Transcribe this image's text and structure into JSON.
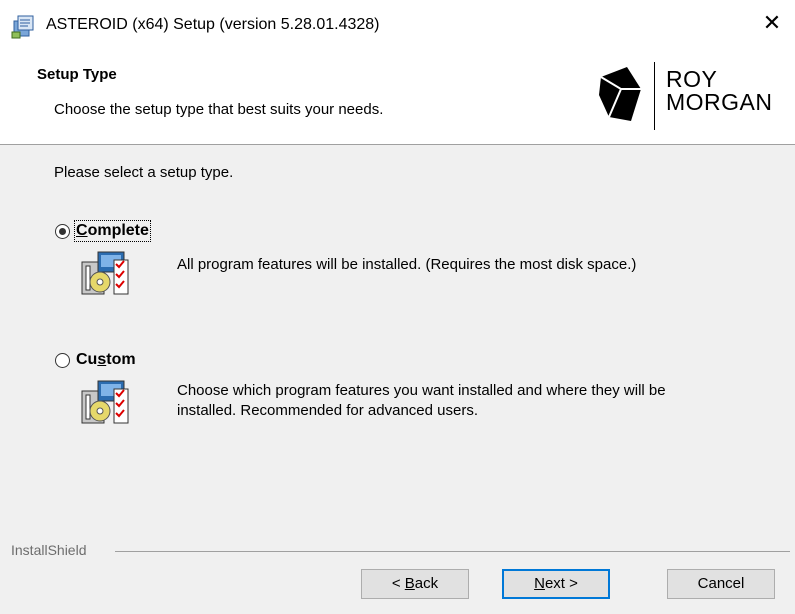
{
  "window": {
    "title": "ASTEROID (x64) Setup (version 5.28.01.4328)",
    "close_glyph": "✕"
  },
  "header": {
    "title": "Setup Type",
    "subtitle": "Choose the setup type that best suits your needs."
  },
  "logo": {
    "line1": "ROY",
    "line2": "MORGAN"
  },
  "prompt": "Please select a setup type.",
  "options": [
    {
      "label_pre": "",
      "label_u": "C",
      "label_post": "omplete",
      "selected": true,
      "description": "All program features will be installed. (Requires the most disk space.)"
    },
    {
      "label_pre": "Cu",
      "label_u": "s",
      "label_post": "tom",
      "selected": false,
      "description": "Choose which program features you want installed and where they will be installed. Recommended for advanced users."
    }
  ],
  "footer": {
    "brand": "InstallShield"
  },
  "buttons": {
    "back": {
      "pre": "< ",
      "u": "B",
      "post": "ack"
    },
    "next": {
      "pre": "",
      "u": "N",
      "post": "ext >"
    },
    "cancel": "Cancel"
  },
  "colors": {
    "accent": "#0078d7",
    "divider": "#a0a0a0"
  },
  "icons": {
    "app": "setup-package-icon",
    "logo": "roy-morgan-logo-mark",
    "feature": "installer-feature-icon"
  }
}
